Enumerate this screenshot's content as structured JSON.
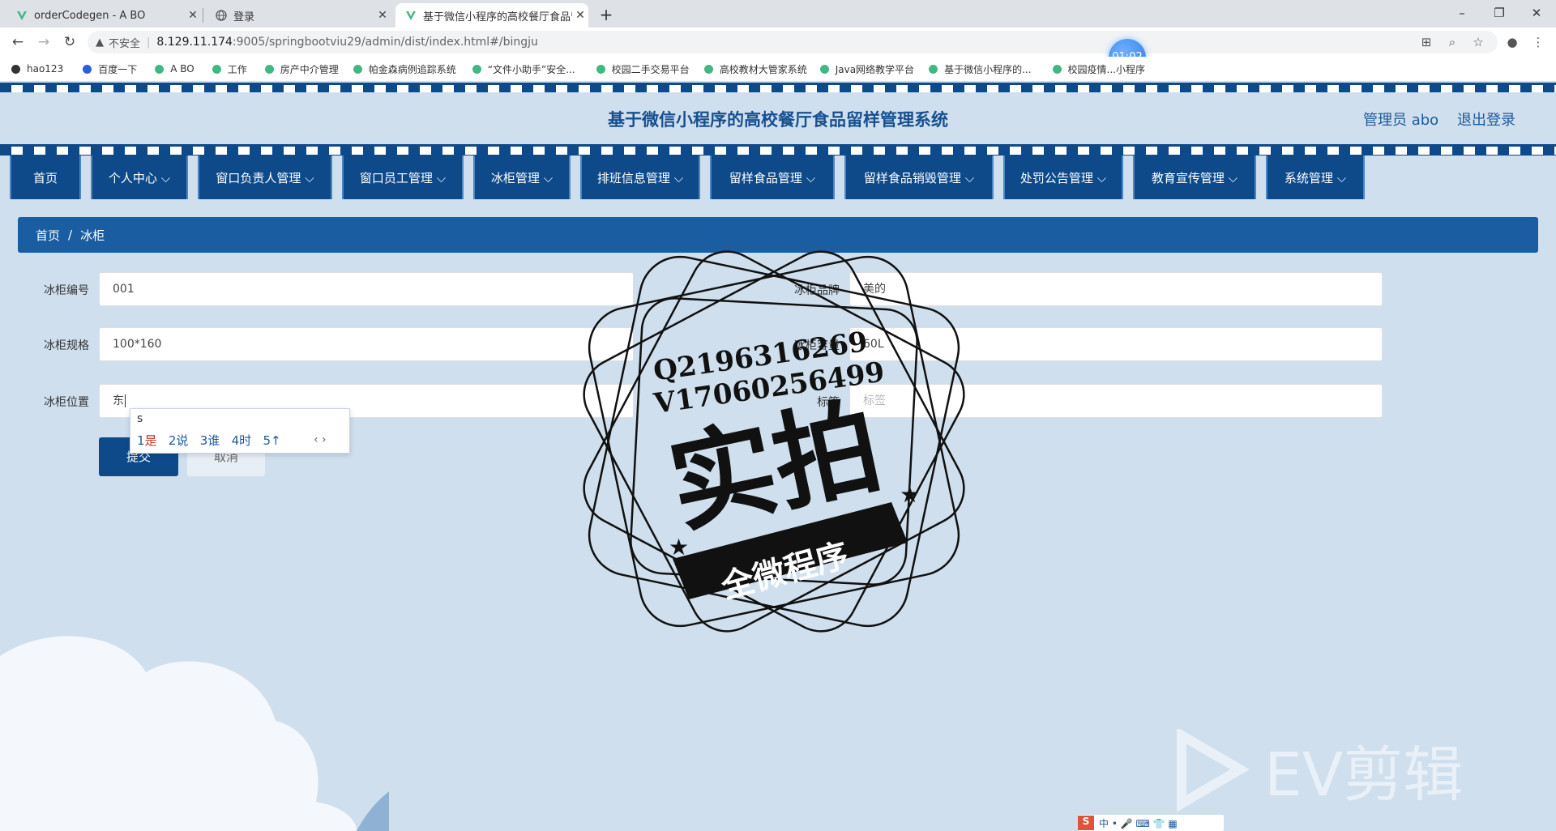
{
  "browser": {
    "tabs": [
      {
        "title": "orderCodegen - A BO",
        "icon": "v-icon"
      },
      {
        "title": "登录",
        "icon": "globe-icon"
      },
      {
        "title": "基于微信小程序的高校餐厅食品留",
        "icon": "v-icon",
        "active": true
      }
    ],
    "security_label": "不安全",
    "url_host": "8.129.11.174",
    "url_path": ":9005/springbootviu29/admin/dist/index.html#/bingju",
    "timer": "01:02",
    "bookmarks": [
      "hao123",
      "百度一下",
      "A BO",
      "工作",
      "房产中介管理",
      "帕金森病例追踪系统",
      "“文件小助手”安全...",
      "校园二手交易平台",
      "高校教材大管家系统",
      "Java网络教学平台",
      "基于微信小程序的...",
      "校园疫情...小程序"
    ]
  },
  "header": {
    "title": "基于微信小程序的高校餐厅食品留样管理系统",
    "admin_label": "管理员 abo",
    "logout_label": "退出登录"
  },
  "menu": [
    {
      "label": "首页"
    },
    {
      "label": "个人中心 ⌵"
    },
    {
      "label": "窗口负责人管理 ⌵"
    },
    {
      "label": "窗口员工管理 ⌵"
    },
    {
      "label": "冰柜管理 ⌵"
    },
    {
      "label": "排班信息管理 ⌵"
    },
    {
      "label": "留样食品管理 ⌵"
    },
    {
      "label": "留样食品销毁管理 ⌵"
    },
    {
      "label": "处罚公告管理 ⌵"
    },
    {
      "label": "教育宣传管理 ⌵"
    },
    {
      "label": "系统管理 ⌵"
    }
  ],
  "breadcrumb": {
    "home": "首页",
    "sep": "/",
    "current": "冰柜"
  },
  "form": {
    "code_label": "冰柜编号",
    "code_value": "001",
    "brand_label": "冰柜品牌",
    "brand_value": "美的",
    "spec_label": "冰柜规格",
    "spec_value": "100*160",
    "capacity_label": "冰柜容量",
    "capacity_value": "60L",
    "location_label": "冰柜位置",
    "location_value": "东",
    "tag_label": "标签",
    "tag_placeholder": "标签",
    "submit_label": "提交",
    "cancel_label": "取消"
  },
  "ime": {
    "composition": "s",
    "candidates": [
      {
        "num": "1",
        "text": "是"
      },
      {
        "num": "2",
        "text": "说"
      },
      {
        "num": "3",
        "text": "谁"
      },
      {
        "num": "4",
        "text": "时"
      },
      {
        "num": "5",
        "text": "↑"
      }
    ],
    "nav": "‹ ›"
  },
  "watermark": {
    "stamp_line1": "Q2196316269",
    "stamp_line2": "V17060256499",
    "stamp_main": "实拍",
    "stamp_banner": "全微程序",
    "ev_text": "EV剪辑"
  },
  "taskbar": {
    "ime_status": "中 • 🎤 ⌨ 👕 ▦"
  }
}
